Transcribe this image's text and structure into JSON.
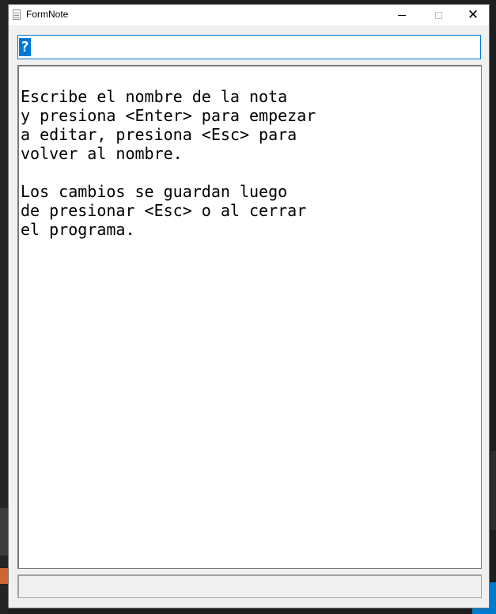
{
  "window": {
    "title": "FormNote",
    "icon": "notepad-icon",
    "controls": {
      "minimize": "minimize-icon",
      "maximize": "maximize-icon",
      "close": "close-icon"
    }
  },
  "name_field": {
    "value": "?",
    "selected": true
  },
  "editor": {
    "text": "Escribe el nombre de la nota\ny presiona <Enter> para empezar\na editar, presiona <Esc> para\nvolver al nombre.\n\nLos cambios se guardan luego\nde presionar <Esc> o al cerrar\nel programa."
  },
  "status_bar": {
    "text": ""
  },
  "colors": {
    "accent": "#0078d7",
    "window_bg": "#f0f0f0",
    "editor_bg": "#ffffff"
  }
}
